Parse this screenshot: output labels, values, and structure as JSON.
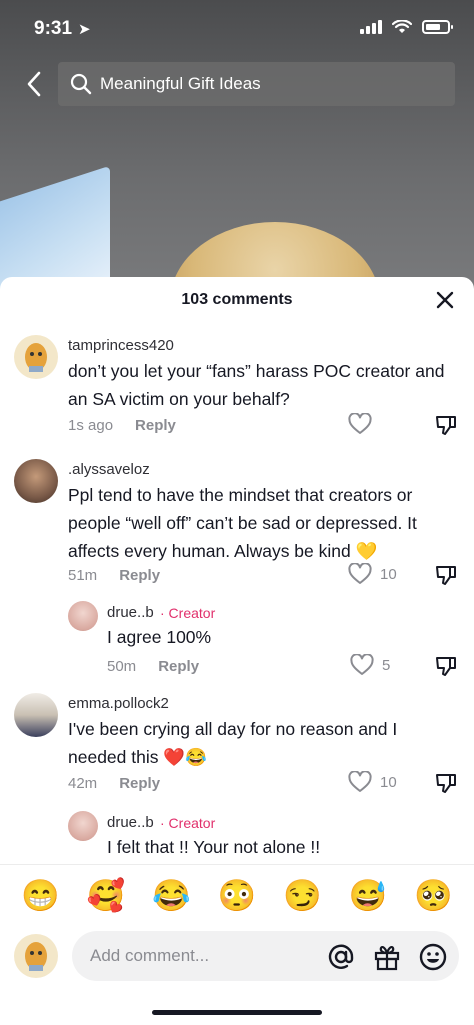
{
  "status": {
    "time": "9:31"
  },
  "search": {
    "query": "Meaningful Gift Ideas"
  },
  "sheet": {
    "title": "103 comments"
  },
  "comments": [
    {
      "username": "tamprincess420",
      "text": "don’t you let your “fans” harass POC creator and an SA victim on your behalf?",
      "time": "1s ago",
      "reply": "Reply",
      "likes": ""
    },
    {
      "username": ".alyssaveloz",
      "text": "Ppl tend to have the mindset that creators or people “well off” can’t be sad or depressed. It affects every human. Always be kind 💛",
      "time": "51m",
      "reply": "Reply",
      "likes": "10"
    },
    {
      "username": "drue..b",
      "creator": "· Creator",
      "text": "I agree 100%",
      "time": "50m",
      "reply": "Reply",
      "likes": "5"
    },
    {
      "username": "emma.pollock2",
      "text": "I've been crying all day for no reason and I needed this ❤️😂",
      "time": "42m",
      "reply": "Reply",
      "likes": "10"
    },
    {
      "username": "drue..b",
      "creator": "· Creator",
      "text": "I felt that !! Your not alone !!",
      "time": "",
      "reply": "",
      "likes": ""
    }
  ],
  "emojis": [
    "😁",
    "🥰",
    "😂",
    "😳",
    "😏",
    "😅",
    "🥺"
  ],
  "input": {
    "placeholder": "Add comment..."
  },
  "colors": {
    "creator": "#e1306c",
    "muted": "#8a8b91"
  }
}
